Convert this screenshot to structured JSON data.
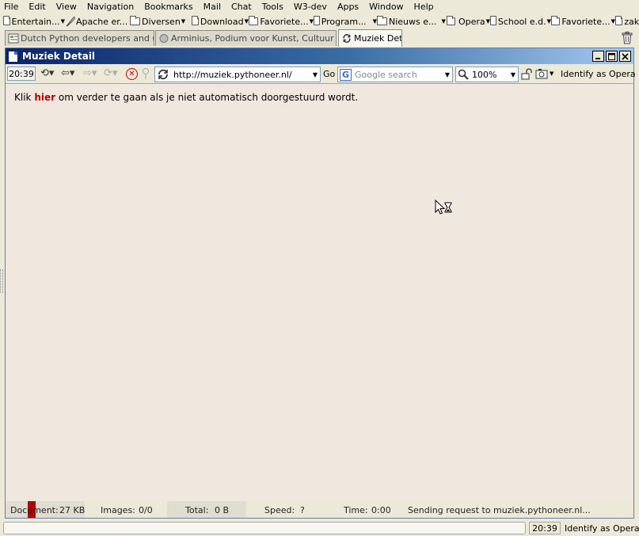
{
  "menus": [
    "File",
    "Edit",
    "View",
    "Navigation",
    "Bookmarks",
    "Mail",
    "Chat",
    "Tools",
    "W3-dev",
    "Apps",
    "Window",
    "Help"
  ],
  "bookmarks": [
    {
      "label": "Entertain...",
      "icon": "folder-icon",
      "width": 82
    },
    {
      "label": "Apache er...",
      "icon": "feather-icon",
      "width": 82
    },
    {
      "label": "Diversen",
      "icon": "folder-icon",
      "width": 78
    },
    {
      "label": "Download",
      "icon": "folder-icon",
      "width": 72
    },
    {
      "label": "Favoriete...",
      "icon": "folder-icon",
      "width": 82
    },
    {
      "label": "Program...",
      "icon": "folder-icon",
      "width": 80
    },
    {
      "label": "Nieuws e...",
      "icon": "folder-icon",
      "width": 88
    },
    {
      "label": "Opera",
      "icon": "folder-icon",
      "width": 55
    },
    {
      "label": "School e.d.",
      "icon": "folder-icon",
      "width": 77
    },
    {
      "label": "Favoriete...",
      "icon": "folder-icon",
      "width": 81
    },
    {
      "label": "zaken",
      "icon": "folder-icon",
      "width": 50
    }
  ],
  "tabs": [
    {
      "label": "Dutch Python developers and users",
      "active": false
    },
    {
      "label": "Arminius, Podium voor Kunst, Cultuur en ...",
      "active": false
    },
    {
      "label": "Muziek Detail",
      "active": true
    }
  ],
  "window": {
    "title": "Muziek Detail"
  },
  "toolbar": {
    "time": "20:39",
    "url": "http://muziek.pythoneer.nl/",
    "go_label": "Go",
    "search_placeholder": "Google search",
    "zoom": "100%",
    "identify": "Identify as Opera"
  },
  "content": {
    "before_link": "Klik ",
    "link_text": "hier",
    "after_link": " om verder te gaan als je niet automatisch doorgestuurd wordt."
  },
  "status": {
    "document_label": "Document:",
    "document_value": "27 KB",
    "images_label": "Images:",
    "images_value": "0/0",
    "total_label": "Total:",
    "total_value": "0 B",
    "speed_label": "Speed:",
    "speed_value": "?",
    "time_label": "Time:",
    "time_value": "0:00",
    "message": "Sending request to muziek.pythoneer.nl..."
  },
  "app_status": {
    "time": "20:39",
    "identify": "Identify as Opera"
  },
  "colors": {
    "content_bg": "#f0e8df",
    "link": "#b00000",
    "title_gradient_start": "#0a246a",
    "title_gradient_end": "#a6caf0"
  }
}
